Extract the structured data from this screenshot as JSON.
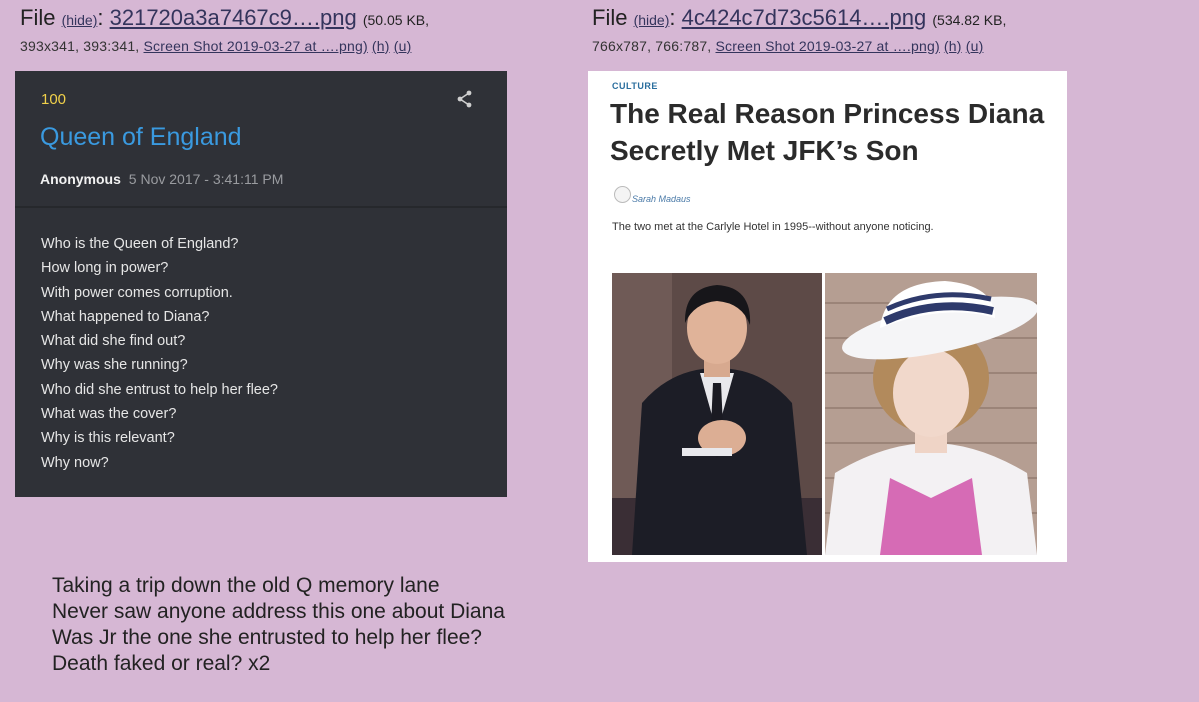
{
  "left_file": {
    "label": "File",
    "hide": "(hide)",
    "filename": "321720a3a7467c9….png",
    "size": "(50.05 KB,",
    "dims": "393x341, 393:341,",
    "orig": "Screen Shot 2019-03-27 at ….png)",
    "h": "(h)",
    "u": "(u)"
  },
  "right_file": {
    "label": "File",
    "hide": "(hide)",
    "filename": "4c424c7d73c5614….png",
    "size": "(534.82 KB,",
    "dims": "766x787, 766:787,",
    "orig": "Screen Shot 2019-03-27 at ….png)",
    "h": "(h)",
    "u": "(u)"
  },
  "q_post": {
    "number": "100",
    "title": "Queen of England",
    "author": "Anonymous",
    "date": "5 Nov 2017 - 3:41:11 PM",
    "lines": [
      "Who is the Queen of England?",
      "How long in power?",
      "With power comes corruption.",
      "What happened to Diana?",
      "What did she find out?",
      "Why was she running?",
      "Who did she entrust to help her flee?",
      "What was the cover?",
      "Why is this relevant?",
      "Why now?"
    ]
  },
  "article": {
    "category": "CULTURE",
    "headline": "The Real Reason Princess Diana Secretly Met JFK’s Son",
    "author": "Sarah Madaus",
    "dek": "The two met at the Carlyle Hotel in 1995--without anyone noticing."
  },
  "comment": [
    "Taking a trip down the old Q memory lane",
    "Never saw anyone address this one about Diana",
    "Was Jr the one she entrusted to help her flee?",
    "Death faked or real? x2"
  ],
  "colors": {
    "page_bg": "#d6b7d4",
    "link": "#34345c",
    "q_number": "#f1d14a",
    "q_title": "#3a9ae0"
  }
}
